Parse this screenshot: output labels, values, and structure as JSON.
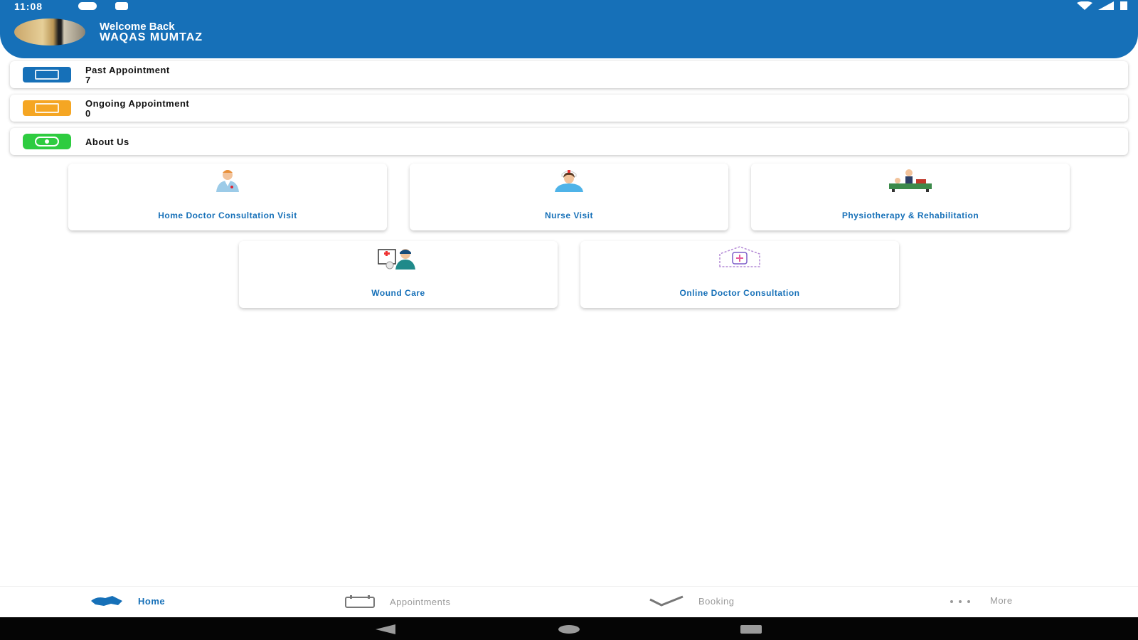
{
  "status_bar": {
    "time": "11:08"
  },
  "header": {
    "welcome": "Welcome Back",
    "username": "WAQAS MUMTAZ"
  },
  "rows": [
    {
      "title": "Past Appointment",
      "count": "7",
      "icon": "calendar-icon",
      "color": "#1670b8"
    },
    {
      "title": "Ongoing Appointment",
      "count": "0",
      "icon": "calendar-icon",
      "color": "#f5a623"
    },
    {
      "title": "About Us",
      "icon": "info-icon",
      "color": "#2ecc40"
    }
  ],
  "services": [
    {
      "label": "Home Doctor Consultation Visit",
      "icon": "doctor-icon"
    },
    {
      "label": "Nurse Visit",
      "icon": "nurse-icon"
    },
    {
      "label": "Physiotherapy & Rehabilitation",
      "icon": "physio-icon"
    },
    {
      "label": "Wound Care",
      "icon": "wound-care-icon"
    },
    {
      "label": "Online Doctor Consultation",
      "icon": "online-consult-icon"
    }
  ],
  "nav": {
    "home": "Home",
    "appointments": "Appointments",
    "booking": "Booking",
    "more": "More"
  },
  "colors": {
    "primary": "#1670b8",
    "orange": "#f5a623",
    "green": "#2ecc40"
  }
}
